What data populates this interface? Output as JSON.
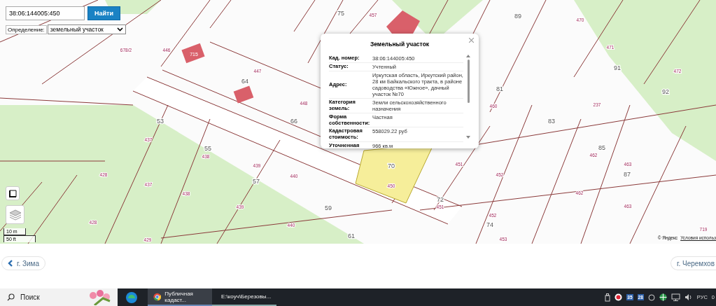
{
  "search": {
    "value": "38:06:144005:450",
    "button": "Найти"
  },
  "definition": {
    "label": "Определение:",
    "value": "земельный участок"
  },
  "map": {
    "labels": [
      {
        "text": "75",
        "kind": "block"
      },
      {
        "text": "457",
        "kind": "parcel"
      },
      {
        "text": "89",
        "kind": "block"
      },
      {
        "text": "470",
        "kind": "parcel"
      },
      {
        "text": "678/2",
        "kind": "parcel"
      },
      {
        "text": "446",
        "kind": "parcel"
      },
      {
        "text": "715",
        "kind": "building"
      },
      {
        "text": "471",
        "kind": "parcel"
      },
      {
        "text": "447",
        "kind": "parcel"
      },
      {
        "text": "91",
        "kind": "block"
      },
      {
        "text": "472",
        "kind": "parcel"
      },
      {
        "text": "64",
        "kind": "block"
      },
      {
        "text": "81",
        "kind": "block"
      },
      {
        "text": "92",
        "kind": "block"
      },
      {
        "text": "448",
        "kind": "parcel"
      },
      {
        "text": "460",
        "kind": "parcel"
      },
      {
        "text": "237",
        "kind": "parcel"
      },
      {
        "text": "53",
        "kind": "block"
      },
      {
        "text": "66",
        "kind": "block"
      },
      {
        "text": "83",
        "kind": "block"
      },
      {
        "text": "437",
        "kind": "parcel"
      },
      {
        "text": "55",
        "kind": "block"
      },
      {
        "text": "85",
        "kind": "block"
      },
      {
        "text": "438",
        "kind": "parcel"
      },
      {
        "text": "462",
        "kind": "parcel"
      },
      {
        "text": "439",
        "kind": "parcel"
      },
      {
        "text": "70",
        "kind": "block"
      },
      {
        "text": "451",
        "kind": "parcel"
      },
      {
        "text": "463",
        "kind": "parcel"
      },
      {
        "text": "428",
        "kind": "parcel"
      },
      {
        "text": "440",
        "kind": "parcel"
      },
      {
        "text": "452",
        "kind": "parcel"
      },
      {
        "text": "87",
        "kind": "block"
      },
      {
        "text": "437",
        "kind": "parcel"
      },
      {
        "text": "57",
        "kind": "block"
      },
      {
        "text": "450",
        "kind": "parcel"
      },
      {
        "text": "438",
        "kind": "parcel"
      },
      {
        "text": "462",
        "kind": "parcel"
      },
      {
        "text": "72",
        "kind": "block"
      },
      {
        "text": "439",
        "kind": "parcel"
      },
      {
        "text": "59",
        "kind": "block"
      },
      {
        "text": "451",
        "kind": "parcel"
      },
      {
        "text": "463",
        "kind": "parcel"
      },
      {
        "text": "452",
        "kind": "parcel"
      },
      {
        "text": "428",
        "kind": "parcel"
      },
      {
        "text": "440",
        "kind": "parcel"
      },
      {
        "text": "74",
        "kind": "block"
      },
      {
        "text": "719",
        "kind": "parcel"
      },
      {
        "text": "429",
        "kind": "parcel"
      },
      {
        "text": "61",
        "kind": "block"
      },
      {
        "text": "453",
        "kind": "parcel"
      }
    ],
    "scale": [
      "10 m",
      "50 ft"
    ],
    "copyright": "© Яндекс",
    "terms_link": "Условия использ"
  },
  "popup": {
    "title": "Земельный участок",
    "rows": [
      {
        "label": "Кад. номер:",
        "value": "38:06:144005:450"
      },
      {
        "label": "Статус:",
        "value": "Учтенный"
      },
      {
        "label": "Адрес:",
        "value": "Иркутская область, Иркутский район, 28 км Байкальского тракта, в районе садоводства «Южное», дачный участок №70"
      },
      {
        "label": "Категория земель:",
        "value": "Земли сельскохозяйственного назначения"
      },
      {
        "label": "Форма собственности:",
        "value": "Частная"
      },
      {
        "label": "Кадастровая стоимость:",
        "value": "558029.22 руб"
      },
      {
        "label": "Уточненная",
        "value": "966 кв.м"
      }
    ]
  },
  "nav": {
    "prev": "г. Зима",
    "next": "г. Черемхов"
  },
  "taskbar": {
    "search_placeholder": "Поиск",
    "tasks": [
      {
        "label": "Публичная кадаст...",
        "selected": true
      },
      {
        "label": "E:\\коуч\\Березовы...",
        "selected": false
      }
    ],
    "tray_badges": [
      "35",
      "28"
    ],
    "language": "РУС",
    "clock": "0"
  }
}
